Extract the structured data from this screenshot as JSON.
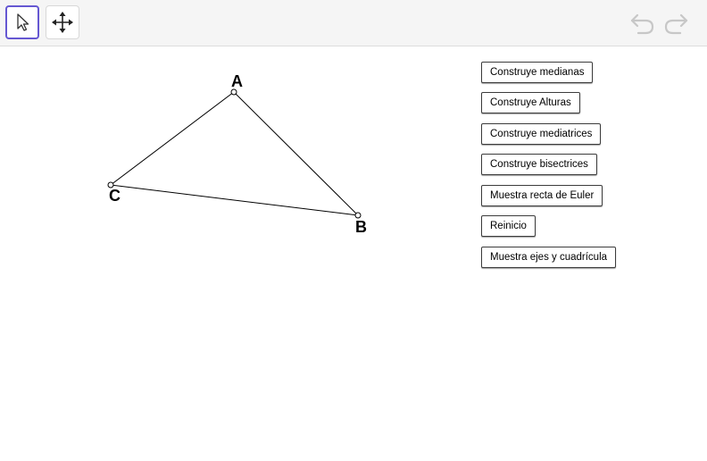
{
  "toolbar": {
    "tools": [
      {
        "name": "move-tool",
        "icon": "arrow-pointer-icon",
        "active": true
      },
      {
        "name": "move-graphics-view-tool",
        "icon": "move-arrows-icon",
        "active": false
      }
    ],
    "undo_icon": "undo-icon",
    "redo_icon": "redo-icon",
    "accent_color": "#6557d2",
    "disabled_icon_color": "#c7c7c7"
  },
  "points": {
    "A": {
      "label": "A"
    },
    "B": {
      "label": "B"
    },
    "C": {
      "label": "C"
    }
  },
  "buttons": [
    {
      "id": "medianas",
      "label": "Construye medianas"
    },
    {
      "id": "alturas",
      "label": "Construye Alturas"
    },
    {
      "id": "mediatrices",
      "label": "Construye mediatrices"
    },
    {
      "id": "bisectrices",
      "label": "Construye bisectrices"
    },
    {
      "id": "euler",
      "label": "Muestra recta de Euler"
    },
    {
      "id": "reinicio",
      "label": "Reinicio"
    },
    {
      "id": "ejes",
      "label": "Muestra ejes y cuadrícula"
    }
  ]
}
